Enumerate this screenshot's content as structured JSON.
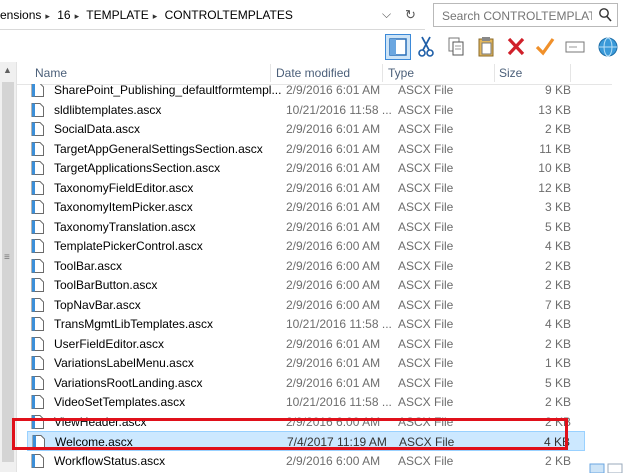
{
  "address": {
    "crumbs": [
      "ensions",
      "16",
      "TEMPLATE",
      "CONTROLTEMPLATES"
    ],
    "dropdown_icon": "chevron-down-icon",
    "refresh_icon": "refresh-icon"
  },
  "search": {
    "placeholder": "Search CONTROLTEMPLATES"
  },
  "toolbar": {
    "items": [
      "details-pane-icon",
      "cut-icon",
      "copy-icon",
      "paste-icon",
      "delete-icon",
      "check-icon",
      "rename-icon",
      "globe-icon"
    ]
  },
  "columns": {
    "name": "Name",
    "date": "Date modified",
    "type": "Type",
    "size": "Size"
  },
  "files": [
    {
      "name": "SharePoint_Publishing_defaultformtempl...",
      "date": "2/9/2016 6:01 AM",
      "type": "ASCX File",
      "size": "9 KB"
    },
    {
      "name": "sldlibtemplates.ascx",
      "date": "10/21/2016 11:58 ...",
      "type": "ASCX File",
      "size": "13 KB"
    },
    {
      "name": "SocialData.ascx",
      "date": "2/9/2016 6:01 AM",
      "type": "ASCX File",
      "size": "2 KB"
    },
    {
      "name": "TargetAppGeneralSettingsSection.ascx",
      "date": "2/9/2016 6:01 AM",
      "type": "ASCX File",
      "size": "11 KB"
    },
    {
      "name": "TargetApplicationsSection.ascx",
      "date": "2/9/2016 6:01 AM",
      "type": "ASCX File",
      "size": "10 KB"
    },
    {
      "name": "TaxonomyFieldEditor.ascx",
      "date": "2/9/2016 6:01 AM",
      "type": "ASCX File",
      "size": "12 KB"
    },
    {
      "name": "TaxonomyItemPicker.ascx",
      "date": "2/9/2016 6:01 AM",
      "type": "ASCX File",
      "size": "3 KB"
    },
    {
      "name": "TaxonomyTranslation.ascx",
      "date": "2/9/2016 6:01 AM",
      "type": "ASCX File",
      "size": "5 KB"
    },
    {
      "name": "TemplatePickerControl.ascx",
      "date": "2/9/2016 6:00 AM",
      "type": "ASCX File",
      "size": "4 KB"
    },
    {
      "name": "ToolBar.ascx",
      "date": "2/9/2016 6:00 AM",
      "type": "ASCX File",
      "size": "2 KB"
    },
    {
      "name": "ToolBarButton.ascx",
      "date": "2/9/2016 6:00 AM",
      "type": "ASCX File",
      "size": "2 KB"
    },
    {
      "name": "TopNavBar.ascx",
      "date": "2/9/2016 6:00 AM",
      "type": "ASCX File",
      "size": "7 KB"
    },
    {
      "name": "TransMgmtLibTemplates.ascx",
      "date": "10/21/2016 11:58 ...",
      "type": "ASCX File",
      "size": "4 KB"
    },
    {
      "name": "UserFieldEditor.ascx",
      "date": "2/9/2016 6:01 AM",
      "type": "ASCX File",
      "size": "2 KB"
    },
    {
      "name": "VariationsLabelMenu.ascx",
      "date": "2/9/2016 6:01 AM",
      "type": "ASCX File",
      "size": "1 KB"
    },
    {
      "name": "VariationsRootLanding.ascx",
      "date": "2/9/2016 6:01 AM",
      "type": "ASCX File",
      "size": "5 KB"
    },
    {
      "name": "VideoSetTemplates.ascx",
      "date": "10/21/2016 11:58 ...",
      "type": "ASCX File",
      "size": "2 KB"
    },
    {
      "name": "ViewHeader.ascx",
      "date": "2/9/2016 6:00 AM",
      "type": "ASCX File",
      "size": "2 KB"
    },
    {
      "name": "Welcome.ascx",
      "date": "7/4/2017 11:19 AM",
      "type": "ASCX File",
      "size": "4 KB"
    },
    {
      "name": "WorkflowStatus.ascx",
      "date": "2/9/2016 6:00 AM",
      "type": "ASCX File",
      "size": "2 KB"
    }
  ],
  "selected_file": "Welcome.ascx",
  "colors": {
    "highlight_border": "#e0101a",
    "selection": "#cce8ff",
    "header_text": "#4c607a"
  }
}
